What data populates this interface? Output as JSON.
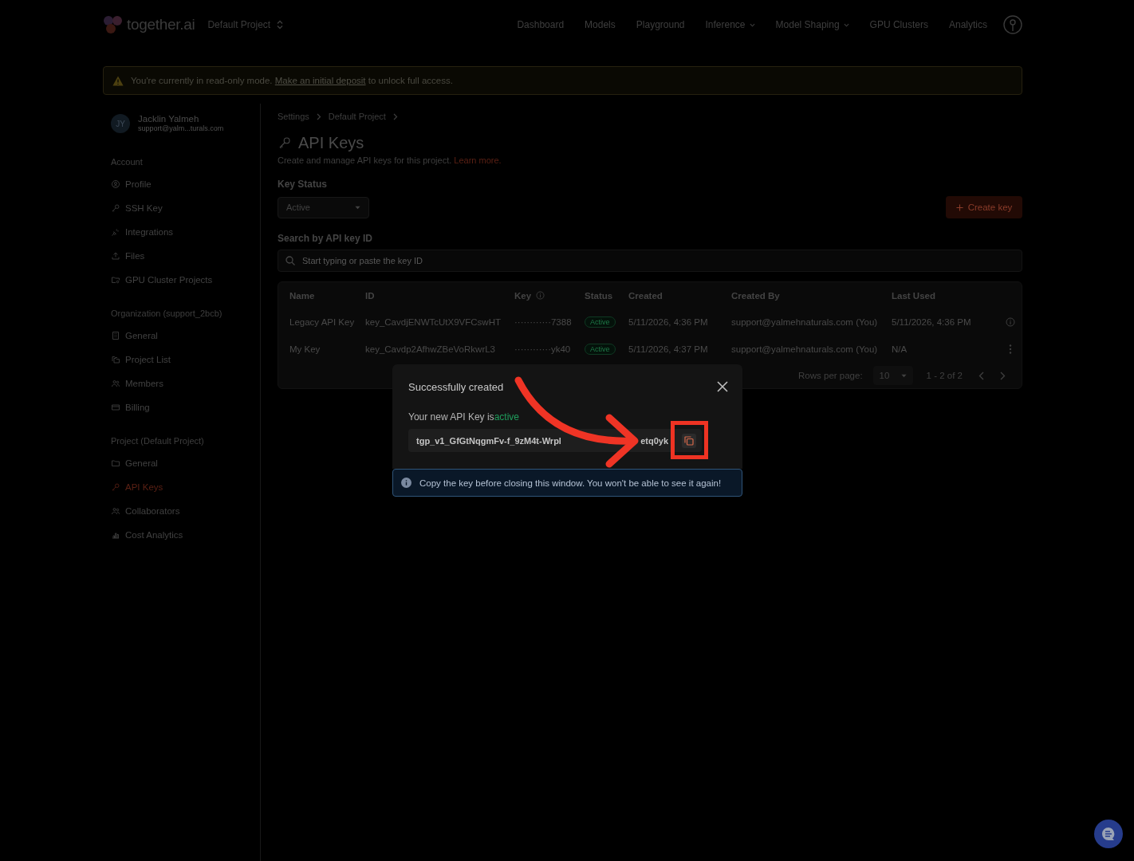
{
  "nav": {
    "brand": "together.ai",
    "project": "Default Project",
    "links": [
      {
        "label": "Dashboard",
        "dropdown": false
      },
      {
        "label": "Models",
        "dropdown": false
      },
      {
        "label": "Playground",
        "dropdown": false
      },
      {
        "label": "Inference",
        "dropdown": true
      },
      {
        "label": "Model Shaping",
        "dropdown": true
      },
      {
        "label": "GPU Clusters",
        "dropdown": false
      },
      {
        "label": "Analytics",
        "dropdown": false
      }
    ]
  },
  "banner": {
    "before": "You're currently in read-only mode.",
    "link": "Make an initial deposit",
    "after": "to unlock full access."
  },
  "sidebar": {
    "user": {
      "initials": "JY",
      "name": "Jacklin Yalmeh",
      "email": "support@yalm...turals.com"
    },
    "sections": [
      {
        "title": "Account",
        "items": [
          {
            "label": "Profile",
            "selected": false
          },
          {
            "label": "SSH Key",
            "selected": false
          },
          {
            "label": "Integrations",
            "selected": false
          },
          {
            "label": "Files",
            "selected": false
          },
          {
            "label": "GPU Cluster Projects",
            "selected": false
          }
        ]
      },
      {
        "title": "Organization (support_2bcb)",
        "items": [
          {
            "label": "General",
            "selected": false
          },
          {
            "label": "Project List",
            "selected": false
          },
          {
            "label": "Members",
            "selected": false
          },
          {
            "label": "Billing",
            "selected": false
          }
        ]
      },
      {
        "title": "Project (Default Project)",
        "items": [
          {
            "label": "General",
            "selected": false
          },
          {
            "label": "API Keys",
            "selected": true
          },
          {
            "label": "Collaborators",
            "selected": false
          },
          {
            "label": "Cost Analytics",
            "selected": false
          }
        ]
      }
    ]
  },
  "page": {
    "breadcrumb": [
      "Settings",
      "Default Project"
    ],
    "title": "API Keys",
    "description": "Create and manage API keys for this project.",
    "learn_more": "Learn more.",
    "filter_label": "Key Status",
    "filter_value": "Active",
    "create_button": "Create key",
    "search_label": "Search by API key ID",
    "search": {
      "placeholder": "Start typing or paste the key ID"
    }
  },
  "table": {
    "columns": [
      {
        "label": "Name",
        "info": false
      },
      {
        "label": "ID",
        "info": false
      },
      {
        "label": "Key",
        "info": true
      },
      {
        "label": "Status",
        "info": false
      },
      {
        "label": "Created",
        "info": false
      },
      {
        "label": "Created By",
        "info": false
      },
      {
        "label": "Last Used",
        "info": false
      }
    ],
    "rows": [
      {
        "kind": "info",
        "name": "Legacy API Key",
        "id": "key_CavdjENWTcUtX9VFCswHT",
        "key": "············7388",
        "status": "Active",
        "created": "5/11/2026, 4:36 PM",
        "created_by": "support@yalmehnaturals.com (You)",
        "last_used": "5/11/2026, 4:36 PM"
      },
      {
        "kind": "menu",
        "name": "My Key",
        "id": "key_Cavdp2AfhwZBeVoRkwrL3",
        "key": "············yk40",
        "status": "Active",
        "created": "5/11/2026, 4:37 PM",
        "created_by": "support@yalmehnaturals.com (You)",
        "last_used": "N/A"
      }
    ],
    "footer": {
      "rows_per_page_label": "Rows per page:",
      "rows_per_page": "10",
      "range": "1 - 2 of 2"
    }
  },
  "modal": {
    "title": "Successfully created",
    "message": "Your new API Key is",
    "status": "active",
    "key_start": "tgp_v1_GfGtNqgmFv-f_9zM4t-Wrpl",
    "key_end": "etq0yk",
    "alert": "Copy the key before closing this window. You won't be able to see it again!"
  }
}
